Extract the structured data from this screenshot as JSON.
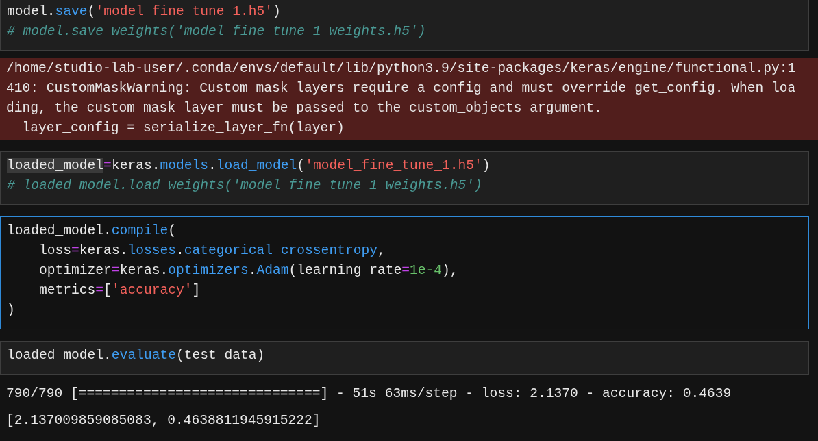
{
  "cells": [
    {
      "kind": "code",
      "selected": false,
      "lines": [
        [
          {
            "kind": "plain",
            "s": "model."
          },
          {
            "kind": "func",
            "s": "save"
          },
          {
            "kind": "plain",
            "s": "("
          },
          {
            "kind": "string",
            "s": "'model_fine_tune_1.h5'"
          },
          {
            "kind": "plain",
            "s": ")"
          }
        ],
        [
          {
            "kind": "comment",
            "s": "# model.save_weights('model_fine_tune_1_weights.h5')"
          }
        ]
      ]
    },
    {
      "kind": "error",
      "lines": [
        "/home/studio-lab-user/.conda/envs/default/lib/python3.9/site-packages/keras/engine/functional.py:1",
        "410: CustomMaskWarning: Custom mask layers require a config and must override get_config. When loa",
        "ding, the custom mask layer must be passed to the custom_objects argument.",
        "  layer_config = serialize_layer_fn(layer)"
      ]
    },
    {
      "kind": "code",
      "selected": false,
      "lines": [
        [
          {
            "kind": "highlight",
            "s": "loaded_model"
          },
          {
            "kind": "operator",
            "s": "="
          },
          {
            "kind": "plain",
            "s": "keras."
          },
          {
            "kind": "func",
            "s": "models"
          },
          {
            "kind": "plain",
            "s": "."
          },
          {
            "kind": "func",
            "s": "load_model"
          },
          {
            "kind": "plain",
            "s": "("
          },
          {
            "kind": "string",
            "s": "'model_fine_tune_1.h5'"
          },
          {
            "kind": "plain",
            "s": ")"
          }
        ],
        [
          {
            "kind": "comment",
            "s": "# loaded_model.load_weights('model_fine_tune_1_weights.h5')"
          }
        ]
      ]
    },
    {
      "kind": "code",
      "selected": true,
      "lines": [
        [
          {
            "kind": "plain",
            "s": "loaded_model."
          },
          {
            "kind": "func",
            "s": "compile"
          },
          {
            "kind": "plain",
            "s": "("
          }
        ],
        [
          {
            "kind": "plain",
            "s": "    loss"
          },
          {
            "kind": "operator",
            "s": "="
          },
          {
            "kind": "plain",
            "s": "keras."
          },
          {
            "kind": "func",
            "s": "losses"
          },
          {
            "kind": "plain",
            "s": "."
          },
          {
            "kind": "func",
            "s": "categorical_crossentropy"
          },
          {
            "kind": "plain",
            "s": ","
          }
        ],
        [
          {
            "kind": "plain",
            "s": "    optimizer"
          },
          {
            "kind": "operator",
            "s": "="
          },
          {
            "kind": "plain",
            "s": "keras."
          },
          {
            "kind": "func",
            "s": "optimizers"
          },
          {
            "kind": "plain",
            "s": "."
          },
          {
            "kind": "func",
            "s": "Adam"
          },
          {
            "kind": "plain",
            "s": "(learning_rate"
          },
          {
            "kind": "operator",
            "s": "="
          },
          {
            "kind": "number",
            "s": "1e-4"
          },
          {
            "kind": "plain",
            "s": "),"
          }
        ],
        [
          {
            "kind": "plain",
            "s": "    metrics"
          },
          {
            "kind": "operator",
            "s": "="
          },
          {
            "kind": "plain",
            "s": "["
          },
          {
            "kind": "string",
            "s": "'accuracy'"
          },
          {
            "kind": "plain",
            "s": "]"
          }
        ],
        [
          {
            "kind": "plain",
            "s": ")"
          }
        ]
      ]
    },
    {
      "kind": "code",
      "selected": false,
      "lines": [
        [
          {
            "kind": "plain",
            "s": "loaded_model."
          },
          {
            "kind": "func",
            "s": "evaluate"
          },
          {
            "kind": "plain",
            "s": "(test_data)"
          }
        ]
      ]
    },
    {
      "kind": "text",
      "lines": [
        "790/790 [==============================] - 51s 63ms/step - loss: 2.1370 - accuracy: 0.4639",
        "[2.137009859085083, 0.4638811945915222]"
      ]
    }
  ]
}
